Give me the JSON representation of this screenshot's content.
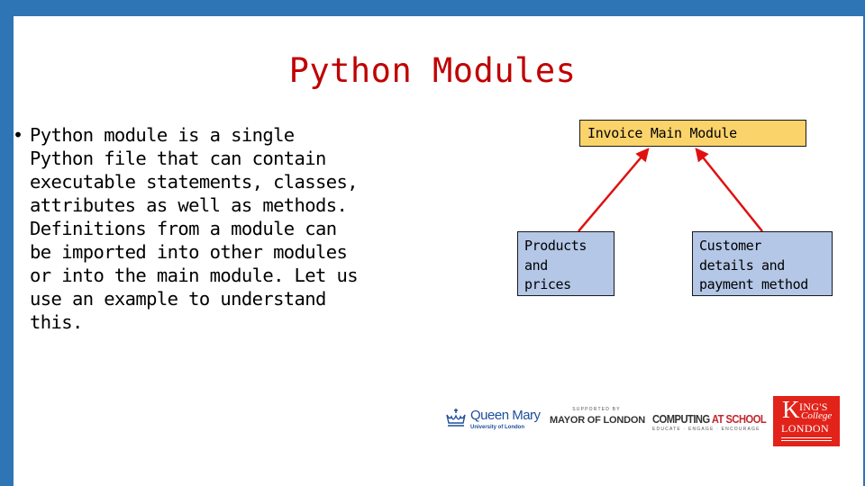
{
  "slide": {
    "title": "Python Modules",
    "bullets": [
      {
        "marker": "•",
        "text": "Python module is a single\nPython file that can contain\nexecutable statements, classes,\nattributes as well as methods.\nDefinitions from a module can\nbe imported into other modules\nor into the main module. Let us\nuse an example to understand\nthis."
      }
    ]
  },
  "diagram": {
    "main_module": {
      "label": "Invoice Main Module",
      "color": "#fbd36b"
    },
    "sub_modules": [
      {
        "label": "Products\nand\nprices",
        "color": "#b4c7e7"
      },
      {
        "label": "Customer\ndetails and\npayment method",
        "color": "#b4c7e7"
      }
    ],
    "arrow_color": "#e01010",
    "connections": [
      {
        "from": "Products and prices",
        "to": "Invoice Main Module"
      },
      {
        "from": "Customer details and payment method",
        "to": "Invoice Main Module"
      }
    ]
  },
  "logos": {
    "queen_mary": {
      "name": "Queen Mary",
      "subtitle": "University of London"
    },
    "mayor": {
      "supertitle": "SUPPORTED BY",
      "name": "MAYOR OF LONDON"
    },
    "computing_at_school": {
      "name_part1": "COMPUTING ",
      "name_part2": "AT SCHOOL",
      "tagline": "EDUCATE · ENGAGE · ENCOURAGE"
    },
    "kings_college": {
      "k": "K",
      "ings": "ING'S",
      "college": "College",
      "london": "LONDON"
    }
  },
  "theme": {
    "frame_color": "#2e75b6",
    "title_color": "#c00000"
  }
}
